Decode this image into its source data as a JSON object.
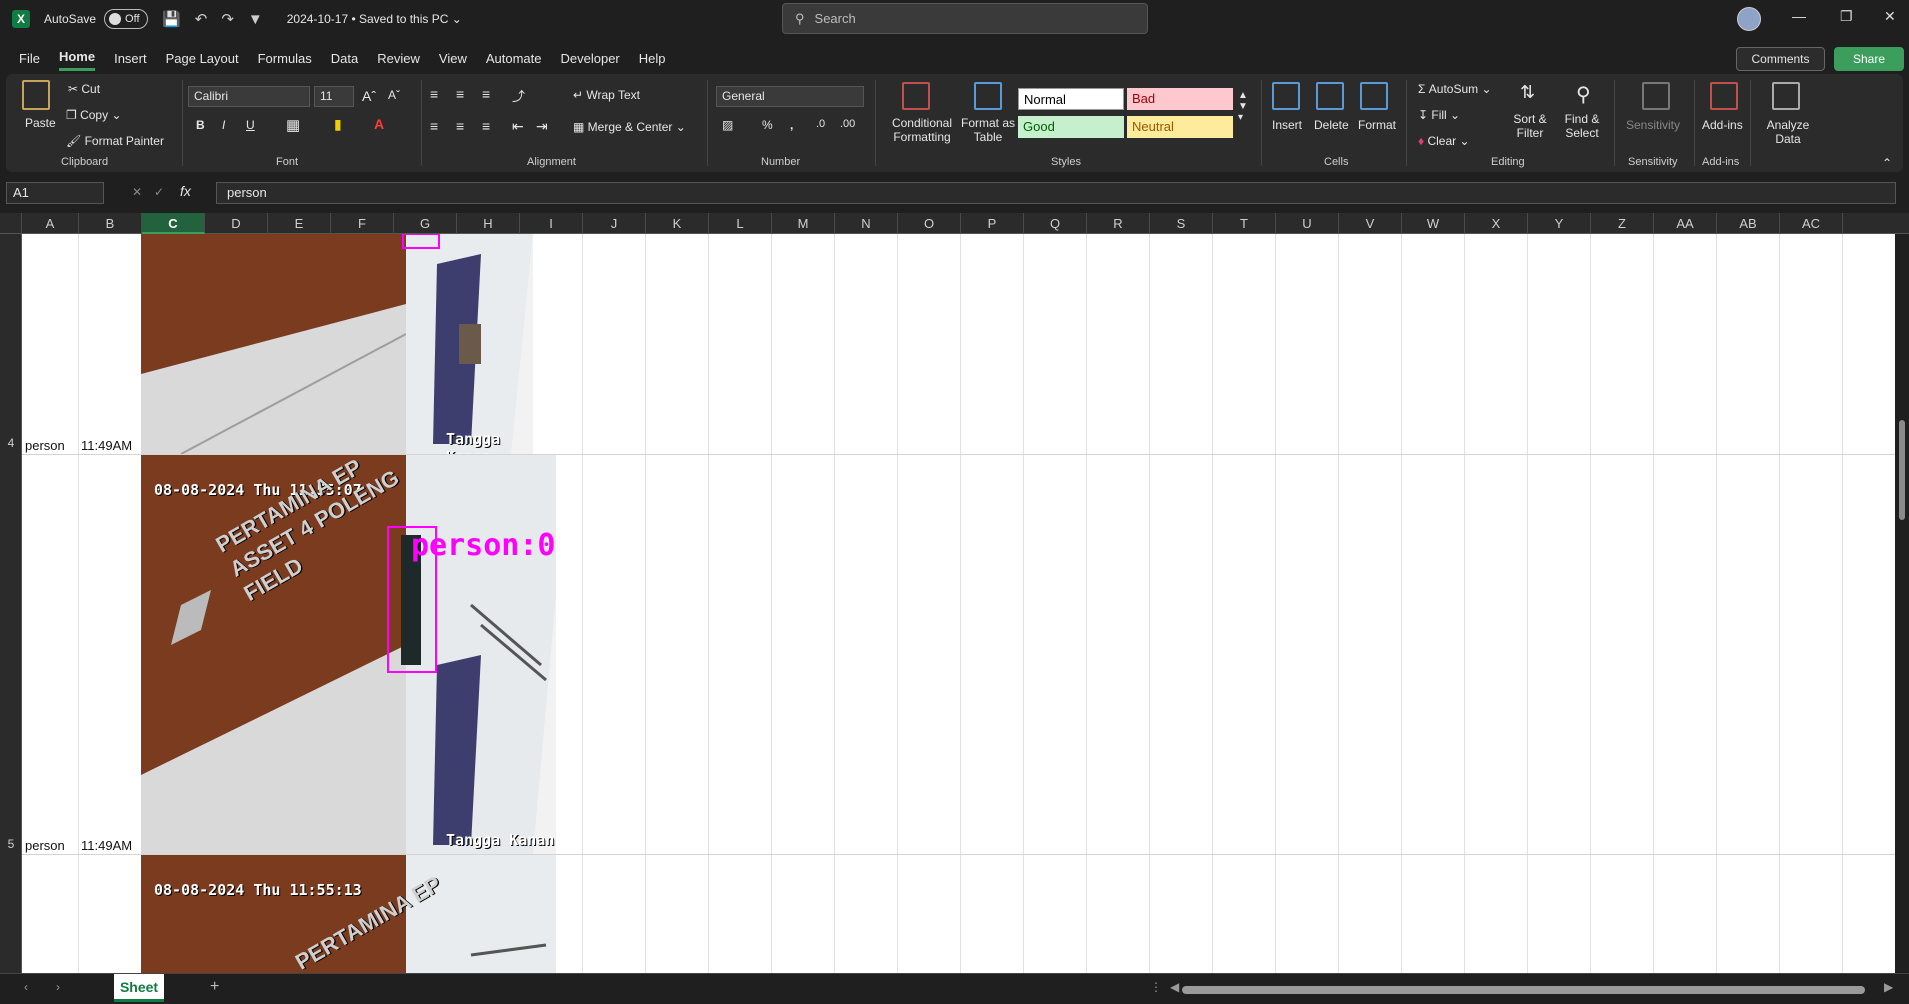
{
  "titlebar": {
    "autosave_label": "AutoSave",
    "autosave_state": "Off",
    "doc_title": "2024-10-17 • Saved to this PC ⌄",
    "search_placeholder": "Search"
  },
  "menu": [
    "File",
    "Home",
    "Insert",
    "Page Layout",
    "Formulas",
    "Data",
    "Review",
    "View",
    "Automate",
    "Developer",
    "Help"
  ],
  "menu_active": "Home",
  "actions": {
    "comments": "Comments",
    "share": "Share"
  },
  "ribbon": {
    "clipboard": {
      "paste": "Paste",
      "cut": "Cut",
      "copy": "Copy",
      "format_painter": "Format Painter",
      "label": "Clipboard"
    },
    "font": {
      "name": "Calibri",
      "size": "11",
      "label": "Font"
    },
    "alignment": {
      "wrap": "Wrap Text",
      "merge": "Merge & Center",
      "label": "Alignment"
    },
    "number": {
      "format": "General",
      "label": "Number"
    },
    "styles": {
      "conditional": "Conditional Formatting",
      "format_table": "Format as Table",
      "normal": "Normal",
      "bad": "Bad",
      "good": "Good",
      "neutral": "Neutral",
      "label": "Styles"
    },
    "cells": {
      "insert": "Insert",
      "delete": "Delete",
      "format": "Format",
      "label": "Cells"
    },
    "editing": {
      "autosum": "AutoSum",
      "fill": "Fill",
      "clear": "Clear",
      "sort": "Sort & Filter",
      "find": "Find & Select",
      "label": "Editing"
    },
    "sensitivity": {
      "button": "Sensitivity",
      "label": "Sensitivity"
    },
    "addins": {
      "button": "Add-ins",
      "label": "Add-ins"
    },
    "analyze": {
      "button": "Analyze Data"
    }
  },
  "formula": {
    "namebox": "A1",
    "fx": "fx",
    "content": "person"
  },
  "columns": [
    "A",
    "B",
    "C",
    "D",
    "E",
    "F",
    "G",
    "H",
    "I",
    "J",
    "K",
    "L",
    "M",
    "N",
    "O",
    "P",
    "Q",
    "R",
    "S",
    "T",
    "U",
    "V",
    "W",
    "X",
    "Y",
    "Z",
    "AA",
    "AB",
    "AC"
  ],
  "selected_column": "C",
  "rows": [
    {
      "num": "4",
      "a": "person",
      "b": "11:49AM"
    },
    {
      "num": "5",
      "a": "person",
      "b": "11:49AM"
    }
  ],
  "images": [
    {
      "caption": "Tangga Kanan",
      "timestamp": ""
    },
    {
      "timestamp": "08-08-2024 Thu 11:55:07",
      "wall_text": "PERTAMINA EP ASSET 4 POLENG FIELD",
      "detection": "person:0",
      "caption": "Tangga Kanan"
    },
    {
      "timestamp": "08-08-2024 Thu 11:55:13",
      "wall_text": "PERTAMINA EP"
    }
  ],
  "sheet_tab": "Sheet"
}
